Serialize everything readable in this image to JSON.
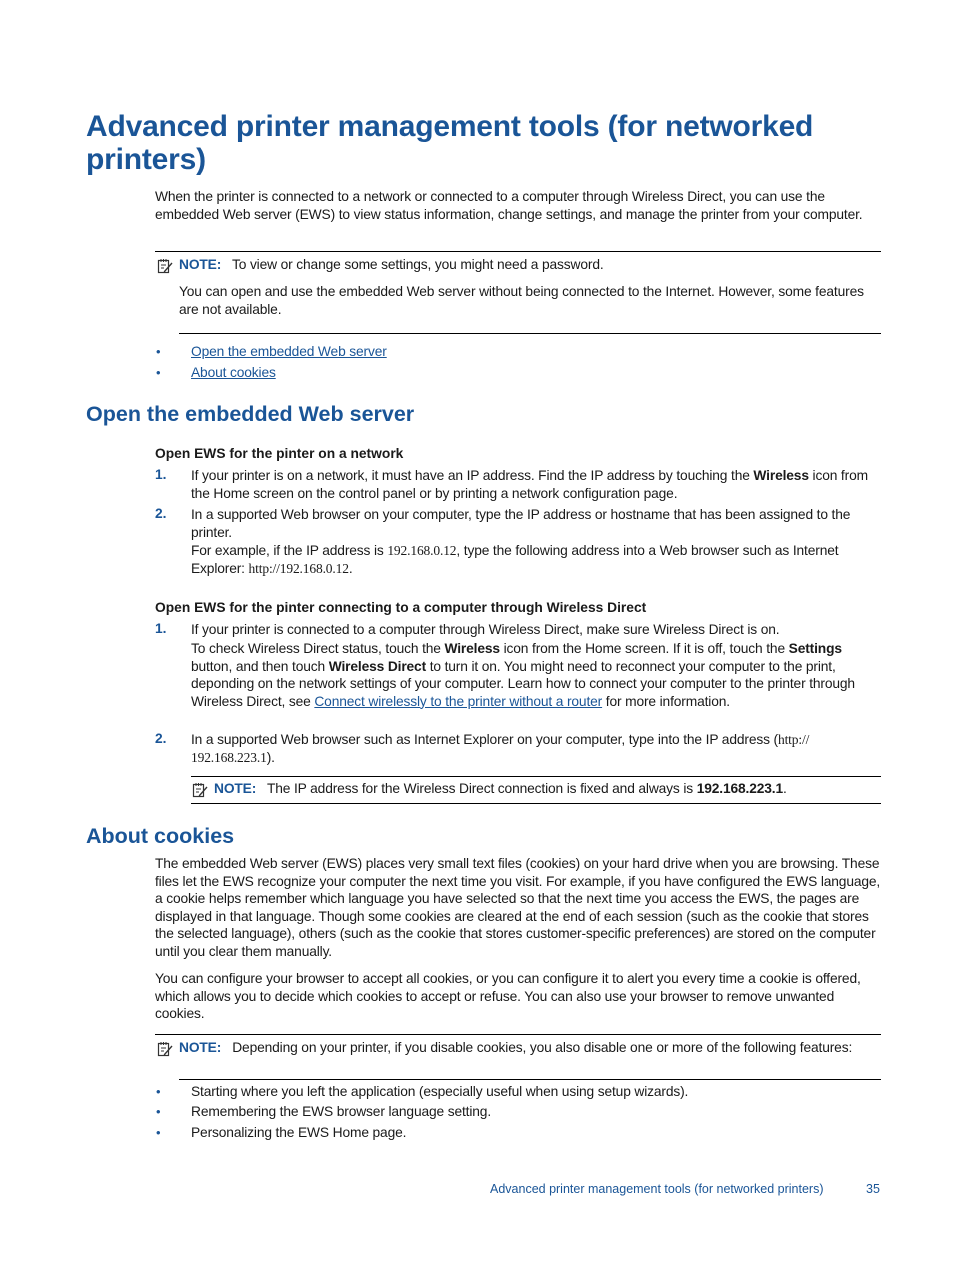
{
  "page": {
    "title": "Advanced printer management tools (for networked printers)",
    "intro": "When the printer is connected to a network or connected to a computer through Wireless Direct, you can use the embedded Web server (EWS) to view status information, change settings, and manage the printer from your computer.",
    "note1": {
      "label": "NOTE:",
      "text": "To view or change some settings, you might need a password.",
      "extra": "You can open and use the embedded Web server without being connected to the Internet. However, some features are not available."
    },
    "toc": [
      {
        "label": "Open the embedded Web server"
      },
      {
        "label": "About cookies"
      }
    ],
    "bullet_glyph": "•"
  },
  "section_open": {
    "heading": "Open the embedded Web server",
    "network": {
      "subheading": "Open EWS for the pinter on a network",
      "steps": [
        {
          "num": "1.",
          "text_a": "If your printer is on a network, it must have an IP address. Find the IP address by touching the ",
          "bold": "Wireless",
          "text_b": " icon from the Home screen on the control panel or by printing a network configuration page."
        },
        {
          "num": "2.",
          "text_a": "In a supported Web browser on your computer, type the IP address or hostname that has been assigned to the printer.",
          "example_a": "For example, if the IP address is ",
          "example_ip": "192.168.0.12",
          "example_b": ", type the following address into a Web browser such as Internet Explorer: ",
          "example_url": "http://192.168.0.12",
          "example_end": "."
        }
      ]
    },
    "direct": {
      "subheading": "Open EWS for the pinter connecting to a computer through Wireless Direct",
      "steps": [
        {
          "num": "1.",
          "line1": "If your printer is connected to a computer through Wireless Direct, make sure Wireless Direct is on.",
          "t1": "To check Wireless Direct status, touch the ",
          "b1": "Wireless",
          "t2": " icon from the Home screen. If it is off, touch the ",
          "b2": "Settings",
          "t3": " button, and then touch ",
          "b3": "Wireless Direct",
          "t4": " to turn it on. You might need to reconnect your computer to the print, deponding on the network settings of your computer. Learn how to connect your computer to the printer through Wireless Direct, see ",
          "link": "Connect wirelessly to the printer without a router",
          "t5": " for more information."
        },
        {
          "num": "2.",
          "text_a": "In a supported Web browser such as Internet Explorer on your computer, type into the IP address (",
          "url": "http:// 192.168.223.1",
          "text_b": ")."
        }
      ],
      "note": {
        "label": "NOTE:",
        "text": "The IP address for the Wireless Direct connection is fixed and always is ",
        "bold": "192.168.223.1",
        "end": "."
      }
    }
  },
  "section_cookies": {
    "heading": "About cookies",
    "para1": "The embedded Web server (EWS) places very small text files (cookies) on your hard drive when you are browsing. These files let the EWS recognize your computer the next time you visit. For example, if you have configured the EWS language, a cookie helps remember which language you have selected so that the next time you access the EWS, the pages are displayed in that language. Though some cookies are cleared at the end of each session (such as the cookie that stores the selected language), others (such as the cookie that stores customer-specific preferences) are stored on the computer until you clear them manually.",
    "para2": "You can configure your browser to accept all cookies, or you can configure it to alert you every time a cookie is offered, which allows you to decide which cookies to accept or refuse. You can also use your browser to remove unwanted cookies.",
    "note": {
      "label": "NOTE:",
      "text": "Depending on your printer, if you disable cookies, you also disable one or more of the following features:"
    },
    "features": [
      "Starting where you left the application (especially useful when using setup wizards).",
      "Remembering the EWS browser language setting.",
      "Personalizing the EWS Home page."
    ]
  },
  "footer": {
    "chapter": "Advanced printer management tools (for networked printers)",
    "page_number": "35"
  },
  "icons": {
    "note": "note-pencil-icon"
  }
}
